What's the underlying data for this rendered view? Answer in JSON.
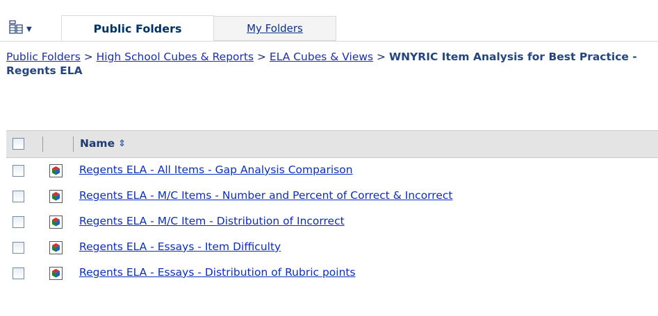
{
  "tabs": [
    {
      "label": "Public Folders",
      "active": true
    },
    {
      "label": "My Folders",
      "active": false
    }
  ],
  "view_menu": {
    "icon": "view-toggle-icon",
    "dropdown_icon": "chevron-down-icon"
  },
  "breadcrumb": {
    "links": [
      "Public Folders",
      "High School Cubes & Reports",
      "ELA Cubes & Views"
    ],
    "separator": " > ",
    "current": "WNYRIC Item Analysis for Best Practice - Regents ELA"
  },
  "table": {
    "header": {
      "name": "Name",
      "sort_icon": "sort-toggle-icon"
    },
    "rows": [
      {
        "name": "Regents ELA - All Items - Gap Analysis Comparison",
        "icon": "cube-icon"
      },
      {
        "name": "Regents ELA - M/C Items - Number and Percent of Correct & Incorrect",
        "icon": "cube-icon"
      },
      {
        "name": "Regents ELA - M/C Item - Distribution of Incorrect",
        "icon": "cube-icon"
      },
      {
        "name": "Regents ELA - Essays - Item Difficulty",
        "icon": "cube-icon"
      },
      {
        "name": "Regents ELA - Essays - Distribution of Rubric points",
        "icon": "cube-icon"
      }
    ]
  },
  "colors": {
    "link": "#0a2ec0",
    "header_bg": "#e4e4e4",
    "tab_border": "#d9d9d9"
  }
}
